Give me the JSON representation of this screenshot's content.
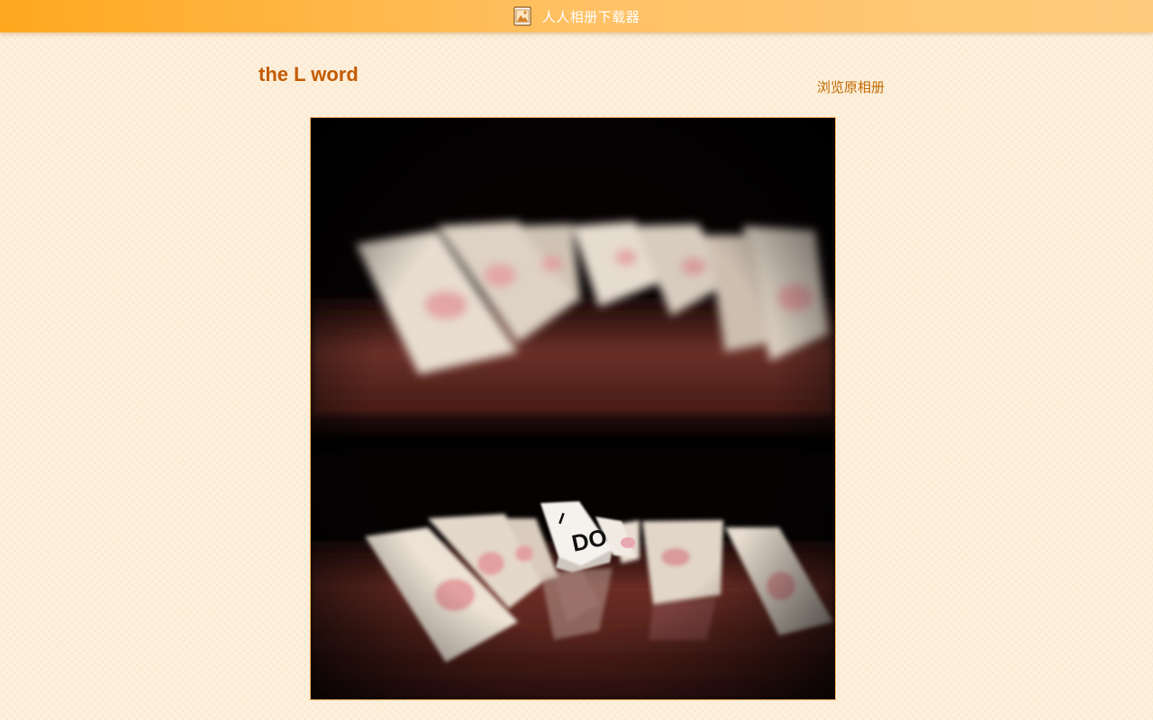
{
  "header": {
    "app_title": "人人相册下载器",
    "app_icon": "photo-album-icon"
  },
  "album": {
    "title": "the L word",
    "browse_link_label": "浏览原相册"
  },
  "photo": {
    "card_text_top": "I",
    "card_text_main": "DO",
    "description": ""
  },
  "colors": {
    "topbar_start": "#ffa81f",
    "topbar_end": "#ffcc7e",
    "title": "#c35b00",
    "link": "#c06a00",
    "frame_border": "#f0a85a",
    "background": "#fdf0dd"
  }
}
